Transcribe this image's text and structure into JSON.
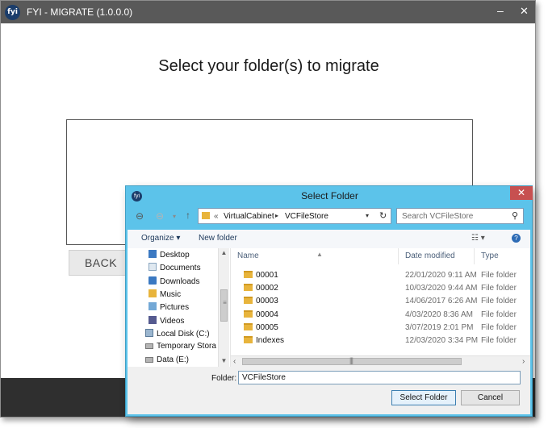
{
  "app": {
    "logo": "fyi",
    "title": "FYI - MIGRATE (1.0.0.0)",
    "minimize": "‒",
    "close": "✕",
    "heading": "Select your folder(s) to migrate",
    "back_label": "BACK"
  },
  "dialog": {
    "title": "Select Folder",
    "close": "✕",
    "address": {
      "prefix": "«",
      "parts": [
        "VirtualCabinet",
        "VCFileStore"
      ],
      "separator": "▸"
    },
    "search_placeholder": "Search VCFileStore",
    "toolbar": {
      "organize": "Organize ▾",
      "new_folder": "New folder"
    },
    "nav_items": [
      {
        "label": "Desktop",
        "icon": "desktop-icon"
      },
      {
        "label": "Documents",
        "icon": "documents-icon"
      },
      {
        "label": "Downloads",
        "icon": "downloads-icon"
      },
      {
        "label": "Music",
        "icon": "music-icon"
      },
      {
        "label": "Pictures",
        "icon": "pictures-icon"
      },
      {
        "label": "Videos",
        "icon": "videos-icon"
      },
      {
        "label": "Local Disk (C:)",
        "icon": "local-disk-icon"
      },
      {
        "label": "Temporary Stora",
        "icon": "drive-icon"
      },
      {
        "label": "Data (E:)",
        "icon": "drive-icon"
      }
    ],
    "columns": {
      "name": "Name",
      "date": "Date modified",
      "type": "Type"
    },
    "files": [
      {
        "name": "00001",
        "date": "22/01/2020 9:11 AM",
        "type": "File folder"
      },
      {
        "name": "00002",
        "date": "10/03/2020 9:44 AM",
        "type": "File folder"
      },
      {
        "name": "00003",
        "date": "14/06/2017 6:26 AM",
        "type": "File folder"
      },
      {
        "name": "00004",
        "date": "4/03/2020 8:36 AM",
        "type": "File folder"
      },
      {
        "name": "00005",
        "date": "3/07/2019 2:01 PM",
        "type": "File folder"
      },
      {
        "name": "Indexes",
        "date": "12/03/2020 3:34 PM",
        "type": "File folder"
      }
    ],
    "folder_label": "Folder:",
    "folder_value": "VCFileStore",
    "select_label": "Select Folder",
    "cancel_label": "Cancel"
  }
}
